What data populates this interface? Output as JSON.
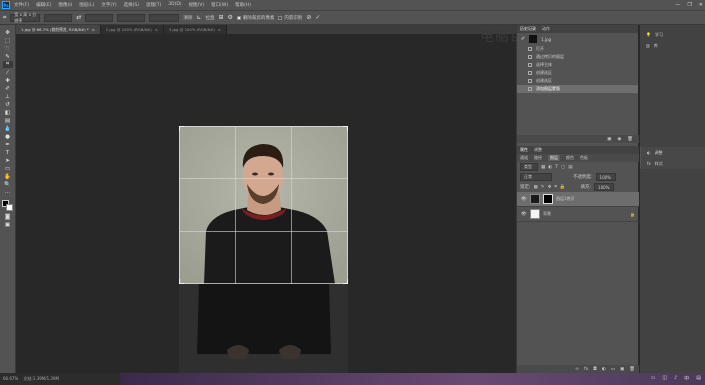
{
  "app": {
    "logo": "Ps"
  },
  "menubar": {
    "items": [
      "文件(F)",
      "编辑(E)",
      "图像(I)",
      "图层(L)",
      "文字(Y)",
      "选择(S)",
      "滤镜(T)",
      "3D(D)",
      "视图(V)",
      "窗口(W)",
      "帮助(H)"
    ],
    "window_controls": [
      "—",
      "❐",
      "✕"
    ]
  },
  "options": {
    "ratio_label": "宽 x 高 x 分辨率",
    "straighten": "拉直",
    "delete_pixels": "删除裁剪的像素",
    "content_aware": "内容识别",
    "clear": "清除",
    "ratio_value": ""
  },
  "tabs": [
    {
      "label": "1.jpg @ 66.7% (裁剪预览, RGB/8#) *",
      "close": "×",
      "active": true
    },
    {
      "label": "2.jpg @ 100% (RGB/8#)",
      "close": "×",
      "active": false
    },
    {
      "label": "3.jpg @ 100% (RGB/8#)",
      "close": "×",
      "active": false
    }
  ],
  "watermark": "电脑百事网",
  "history": {
    "tabs": [
      "历史记录",
      "动作"
    ],
    "snapshot": "1.jpg",
    "items": [
      "打开",
      "通过拷贝的图层",
      "选择主体",
      "创建选区",
      "创建选区",
      "添加图层蒙版"
    ]
  },
  "properties": {
    "tabs": [
      "属性",
      "调整"
    ]
  },
  "layers": {
    "tabs": [
      "通道",
      "路径",
      "图层",
      "颜色",
      "色板"
    ],
    "kind": "类型",
    "mode": "正常",
    "opacity_label": "不透明度:",
    "opacity": "100%",
    "lock_label": "锁定:",
    "fill_label": "填充:",
    "fill": "100%",
    "items": [
      {
        "name": "图层1拷贝",
        "selected": true
      },
      {
        "name": "背景",
        "selected": false
      }
    ]
  },
  "rightcol": {
    "items": [
      "学习",
      "库",
      "调整",
      "样式"
    ]
  },
  "status": {
    "zoom": "66.67%",
    "doc": "文档:1.39M/1.39M"
  }
}
